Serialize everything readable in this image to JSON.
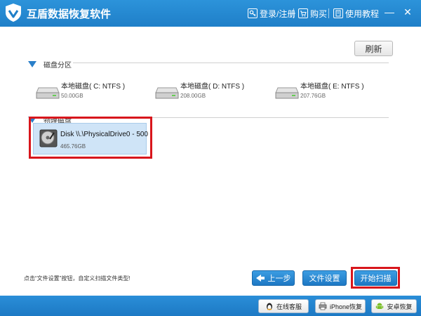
{
  "window": {
    "title": "互盾数据恢复软件",
    "links": {
      "login": "登录/注册",
      "buy": "购买",
      "tutorial": "使用教程"
    },
    "minimize": "—",
    "close": "✕"
  },
  "toolbar": {
    "refresh_label": "刷新"
  },
  "partitions": {
    "label": "磁盘分区",
    "drives": [
      {
        "name": "本地磁盘( C: NTFS )",
        "size": "50.00GB"
      },
      {
        "name": "本地磁盘( D: NTFS )",
        "size": "208.00GB"
      },
      {
        "name": "本地磁盘( E: NTFS )",
        "size": "207.76GB"
      }
    ]
  },
  "physical": {
    "label": "物理磁盘",
    "disk": {
      "name": "Disk \\\\.\\PhysicalDrive0 - 500",
      "size": "465.76GB"
    }
  },
  "footer": {
    "hint": "点击“文件设置”按钮，自定义扫描文件类型!",
    "prev_label": "上一步",
    "settings_label": "文件设置",
    "scan_label": "开始扫描"
  },
  "bottombar": {
    "support_label": "在线客服",
    "iphone_label": "iPhone恢复",
    "android_label": "安卓恢复"
  },
  "colors": {
    "titlebar": "#1f7fc8",
    "highlight": "#d8161c",
    "selected_bg": "#cfe4f7"
  }
}
